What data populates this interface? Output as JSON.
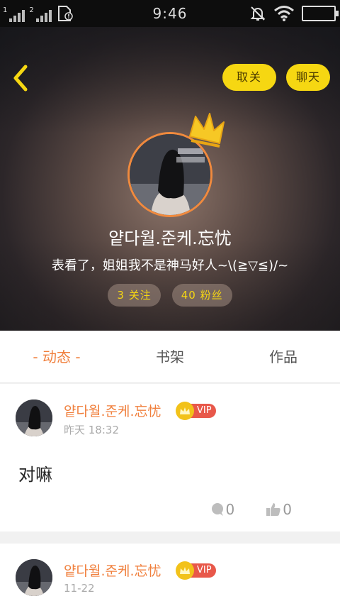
{
  "status_bar": {
    "sim1_label": "1",
    "sim2_label": "2",
    "time": "9:46"
  },
  "header": {
    "follow_label": "取关",
    "chat_label": "聊天",
    "username": "얕다월.준케.忘忧",
    "bio": "表看了，姐姐我不是神马好人~\\(≧▽≦)/~",
    "following_count": "3",
    "following_label": "关注",
    "followers_count": "40",
    "followers_label": "粉丝",
    "colors": {
      "accent_yellow": "#f6d712",
      "accent_orange": "#f07f3c"
    }
  },
  "tabs": {
    "active": "- 动态 -",
    "shelf": "书架",
    "works": "作品"
  },
  "posts": [
    {
      "author": "얕다월.준케.忘忧",
      "badge": "VIP",
      "time": "昨天 18:32",
      "content": "对嘛",
      "comments": "0",
      "likes": "0"
    },
    {
      "author": "얕다월.준케.忘忧",
      "badge": "VIP",
      "time": "11-22"
    }
  ]
}
